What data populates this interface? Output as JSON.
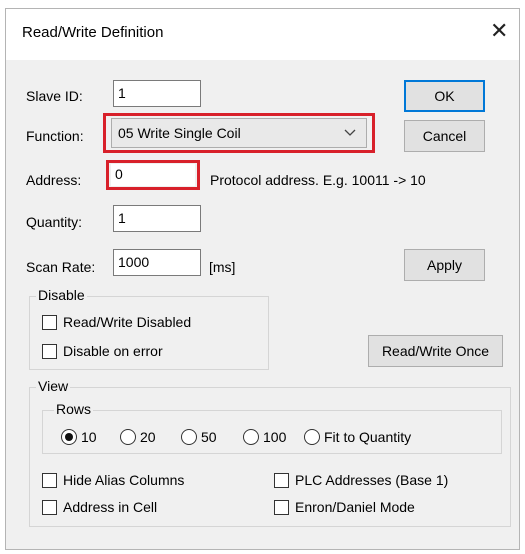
{
  "dialog": {
    "title": "Read/Write Definition",
    "close_glyph": "✕",
    "close_icon": "close-icon"
  },
  "form": {
    "slave_id_label": "Slave ID:",
    "slave_id_value": "1",
    "function_label": "Function:",
    "function_value": "05 Write Single Coil",
    "address_label": "Address:",
    "address_value": "0",
    "address_hint": "Protocol address. E.g. 10011 -> 10",
    "quantity_label": "Quantity:",
    "quantity_value": "1",
    "scan_rate_label": "Scan Rate:",
    "scan_rate_value": "1000",
    "scan_rate_unit": "[ms]"
  },
  "buttons": {
    "ok": "OK",
    "cancel": "Cancel",
    "apply": "Apply",
    "read_write_once": "Read/Write Once"
  },
  "disable_group": {
    "legend": "Disable",
    "read_write_disabled": "Read/Write Disabled",
    "disable_on_error": "Disable on error"
  },
  "view_group": {
    "legend": "View",
    "rows_legend": "Rows",
    "rows_options": [
      "10",
      "20",
      "50",
      "100",
      "Fit to Quantity"
    ],
    "rows_selected": "10",
    "hide_alias_columns": "Hide Alias Columns",
    "address_in_cell": "Address in Cell",
    "plc_addresses": "PLC Addresses (Base 1)",
    "enron_daniel_mode": "Enron/Daniel Mode"
  },
  "colors": {
    "highlight": "#d8202a",
    "default_button_border": "#0078d7"
  }
}
